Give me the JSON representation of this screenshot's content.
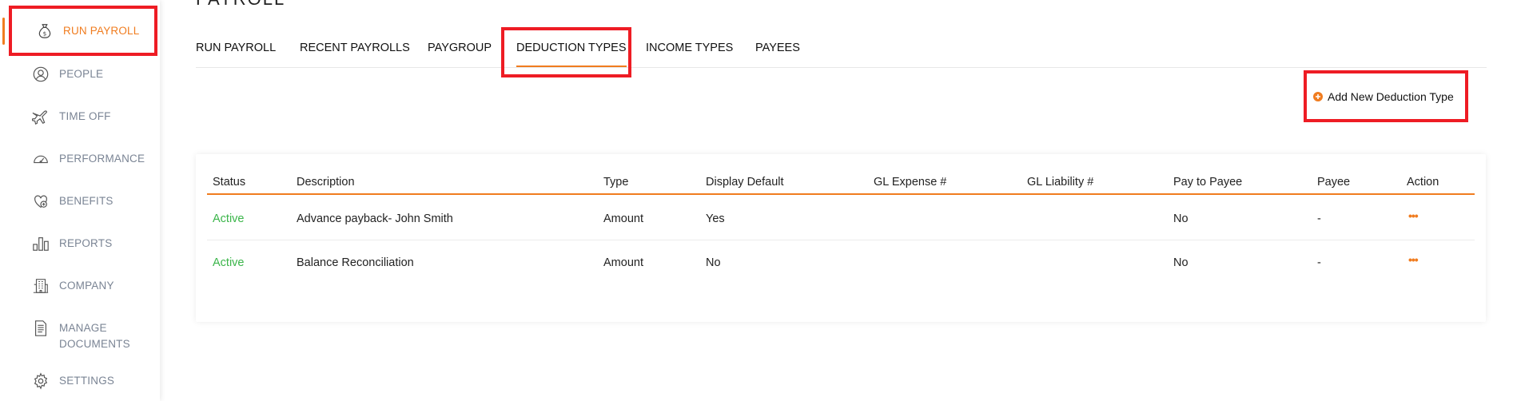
{
  "sidebar": {
    "items": [
      {
        "label": "RUN PAYROLL",
        "icon": "money-bag-icon"
      },
      {
        "label": "PEOPLE",
        "icon": "person-icon"
      },
      {
        "label": "TIME OFF",
        "icon": "airplane-icon"
      },
      {
        "label": "PERFORMANCE",
        "icon": "gauge-icon"
      },
      {
        "label": "BENEFITS",
        "icon": "heart-shield-icon"
      },
      {
        "label": "REPORTS",
        "icon": "bar-chart-icon"
      },
      {
        "label": "COMPANY",
        "icon": "building-icon"
      },
      {
        "label": "MANAGE DOCUMENTS",
        "icon": "document-icon"
      },
      {
        "label": "SETTINGS",
        "icon": "gear-icon"
      }
    ]
  },
  "header": {
    "title": "PAYROLL"
  },
  "tabs": [
    {
      "label": "RUN PAYROLL"
    },
    {
      "label": "RECENT PAYROLLS"
    },
    {
      "label": "PAYGROUP"
    },
    {
      "label": "DEDUCTION TYPES"
    },
    {
      "label": "INCOME TYPES"
    },
    {
      "label": "PAYEES"
    }
  ],
  "actions": {
    "add_label": "Add New Deduction Type"
  },
  "table": {
    "columns": [
      "Status",
      "Description",
      "Type",
      "Display Default",
      "GL Expense #",
      "GL Liability #",
      "Pay to Payee",
      "Payee",
      "Action"
    ],
    "rows": [
      {
        "status": "Active",
        "description": "Advance payback- John Smith",
        "type": "Amount",
        "display_default": "Yes",
        "gl_expense": "",
        "gl_liability": "",
        "pay_to_payee": "No",
        "payee": "-",
        "action": "•••"
      },
      {
        "status": "Active",
        "description": "Balance Reconciliation",
        "type": "Amount",
        "display_default": "No",
        "gl_expense": "",
        "gl_liability": "",
        "pay_to_payee": "No",
        "payee": "-",
        "action": "•••"
      }
    ]
  },
  "colors": {
    "accent": "#f07c1f",
    "active_status": "#3bb54a",
    "highlight": "#ee1c24",
    "sidebar_text": "#7a8494"
  }
}
